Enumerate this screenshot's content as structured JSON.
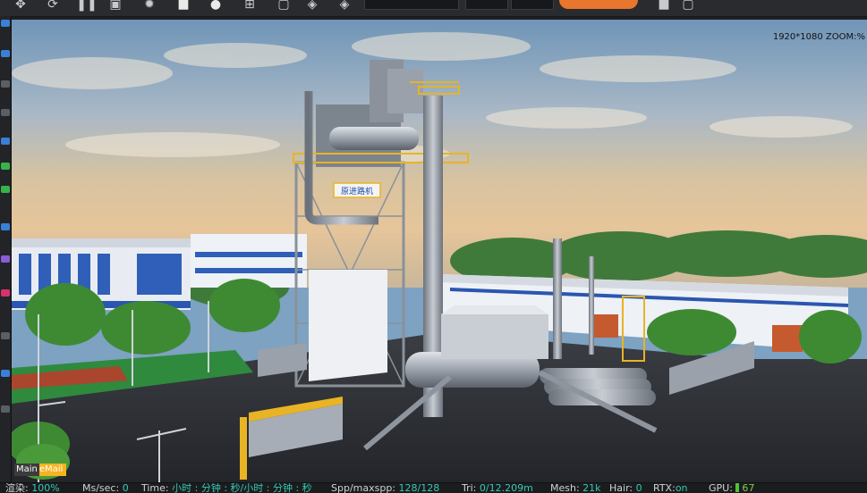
{
  "toolbar": {
    "icons": [
      "move-icon",
      "refresh-icon",
      "pause-icon",
      "camera-icon",
      "gear-icon",
      "material-icon",
      "sphere-icon",
      "add-icon",
      "box-icon",
      "light-icon",
      "bulb-icon"
    ]
  },
  "viewport": {
    "resolution_label": "1920*1080 ZOOM:%",
    "sign_text": "原进路机"
  },
  "tabs": {
    "main": "Main",
    "email": "eMail"
  },
  "status": {
    "render_label": "渲染:",
    "render_value": "100%",
    "ms_label": "Ms/sec:",
    "ms_value": "0",
    "time_label": "Time:",
    "time_value": "小时 : 分钟 : 秒/小时 : 分钟 : 秒",
    "spp_label": "Spp/maxspp:",
    "spp_value": "128/128",
    "tri_label": "Tri:",
    "tri_value": "0/12.209m",
    "mesh_label": "Mesh:",
    "mesh_value": "21k",
    "hair_label": "Hair:",
    "hair_value": "0",
    "rtx_label": "RTX:",
    "rtx_value": "on",
    "gpu_label": "GPU:",
    "gpu_value": "67"
  },
  "colors": {
    "accent_orange": "#e8762c",
    "status_value": "#35c9b4",
    "email_tab": "#f5b320"
  }
}
